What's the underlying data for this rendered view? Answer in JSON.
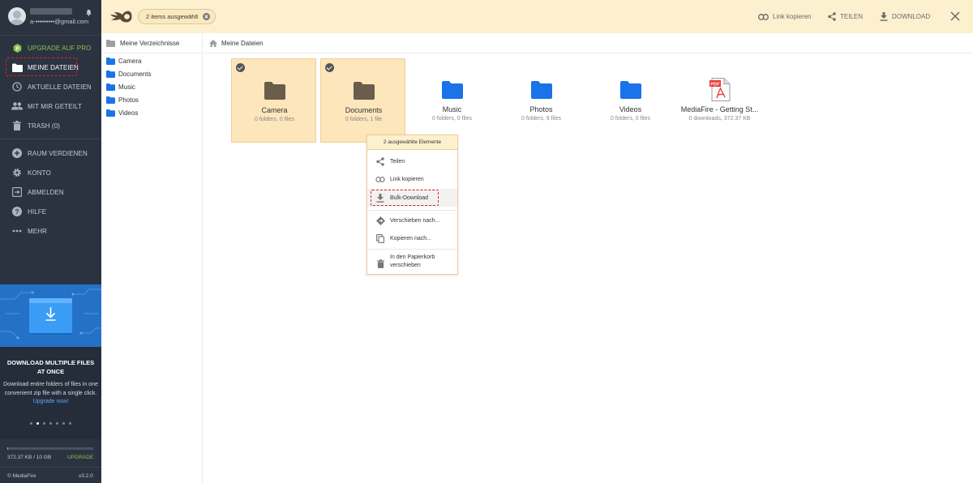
{
  "user": {
    "email": "a-•••••••••@gmail.com"
  },
  "sidebar": {
    "items": [
      {
        "label": "UPGRADE AUF PRO",
        "icon": "upgrade-icon"
      },
      {
        "label": "MEINE DATEIEN",
        "icon": "folder-icon"
      },
      {
        "label": "AKTUELLE DATEIEN",
        "icon": "clock-icon"
      },
      {
        "label": "MIT MIR GETEILT",
        "icon": "people-icon"
      },
      {
        "label": "TRASH (0)",
        "icon": "trash-icon"
      },
      {
        "label": "RAUM VERDIENEN",
        "icon": "plus-circle-icon"
      },
      {
        "label": "KONTO",
        "icon": "gear-icon"
      },
      {
        "label": "ABMELDEN",
        "icon": "logout-icon"
      },
      {
        "label": "HILFE",
        "icon": "help-icon"
      },
      {
        "label": "MEHR",
        "icon": "more-icon"
      }
    ],
    "promo": {
      "title": "DOWNLOAD MULTIPLE FILES AT ONCE",
      "text": "Download entire folders of files in one convenient zip file with a single click.",
      "link": "Upgrade now!",
      "dots_count": 7,
      "active_dot": 1
    },
    "storage": {
      "text": "372.37 KB / 10 GB",
      "upgrade": "UPGRADE",
      "used_fraction": 4e-05
    },
    "footer": {
      "brand": "© MediaFire",
      "version": "v3.2.0"
    }
  },
  "topbar": {
    "selection_label": "2 items ausgewählt",
    "actions": {
      "copy_link": "Link kopieren",
      "share": "TEILEN",
      "download": "DOWNLOAD"
    }
  },
  "folder_pane": {
    "header": "Meine Verzeichnisse",
    "folders": [
      "Camera",
      "Documents",
      "Music",
      "Photos",
      "Videos"
    ]
  },
  "breadcrumb": {
    "label": "Meine Dateien"
  },
  "files": [
    {
      "name": "Camera",
      "meta": "0 folders, 0 files",
      "type": "folder",
      "selected": true
    },
    {
      "name": "Documents",
      "meta": "0 folders, 1 file",
      "type": "folder",
      "selected": true
    },
    {
      "name": "Music",
      "meta": "0 folders, 0 files",
      "type": "folder",
      "selected": false
    },
    {
      "name": "Photos",
      "meta": "0 folders, 9 files",
      "type": "folder",
      "selected": false
    },
    {
      "name": "Videos",
      "meta": "0 folders, 0 files",
      "type": "folder",
      "selected": false
    },
    {
      "name": "MediaFire - Getting St...",
      "meta": "0 downloads, 372.37 KB",
      "type": "pdf",
      "selected": false
    }
  ],
  "context_menu": {
    "header": "2 ausgewählte Elemente",
    "items": [
      {
        "label": "Teilen",
        "icon": "share-icon"
      },
      {
        "label": "Link kopieren",
        "icon": "link-icon"
      },
      {
        "label": "Bulk-Download",
        "icon": "download-icon"
      },
      {
        "label": "Verschieben nach...",
        "icon": "move-icon"
      },
      {
        "label": "Kopieren nach...",
        "icon": "copy-icon"
      },
      {
        "label": "In den Papierkorb verschieben",
        "icon": "trash-icon"
      }
    ]
  },
  "colors": {
    "sidebar_bg": "#2b3341",
    "topbar_bg": "#fdf0cf",
    "selected_tile_bg": "#fde6bb",
    "folder_blue": "#1a73e8",
    "folder_dark": "#6b5d4b",
    "upgrade_green": "#8bc34a",
    "highlight_red": "#e02020"
  }
}
